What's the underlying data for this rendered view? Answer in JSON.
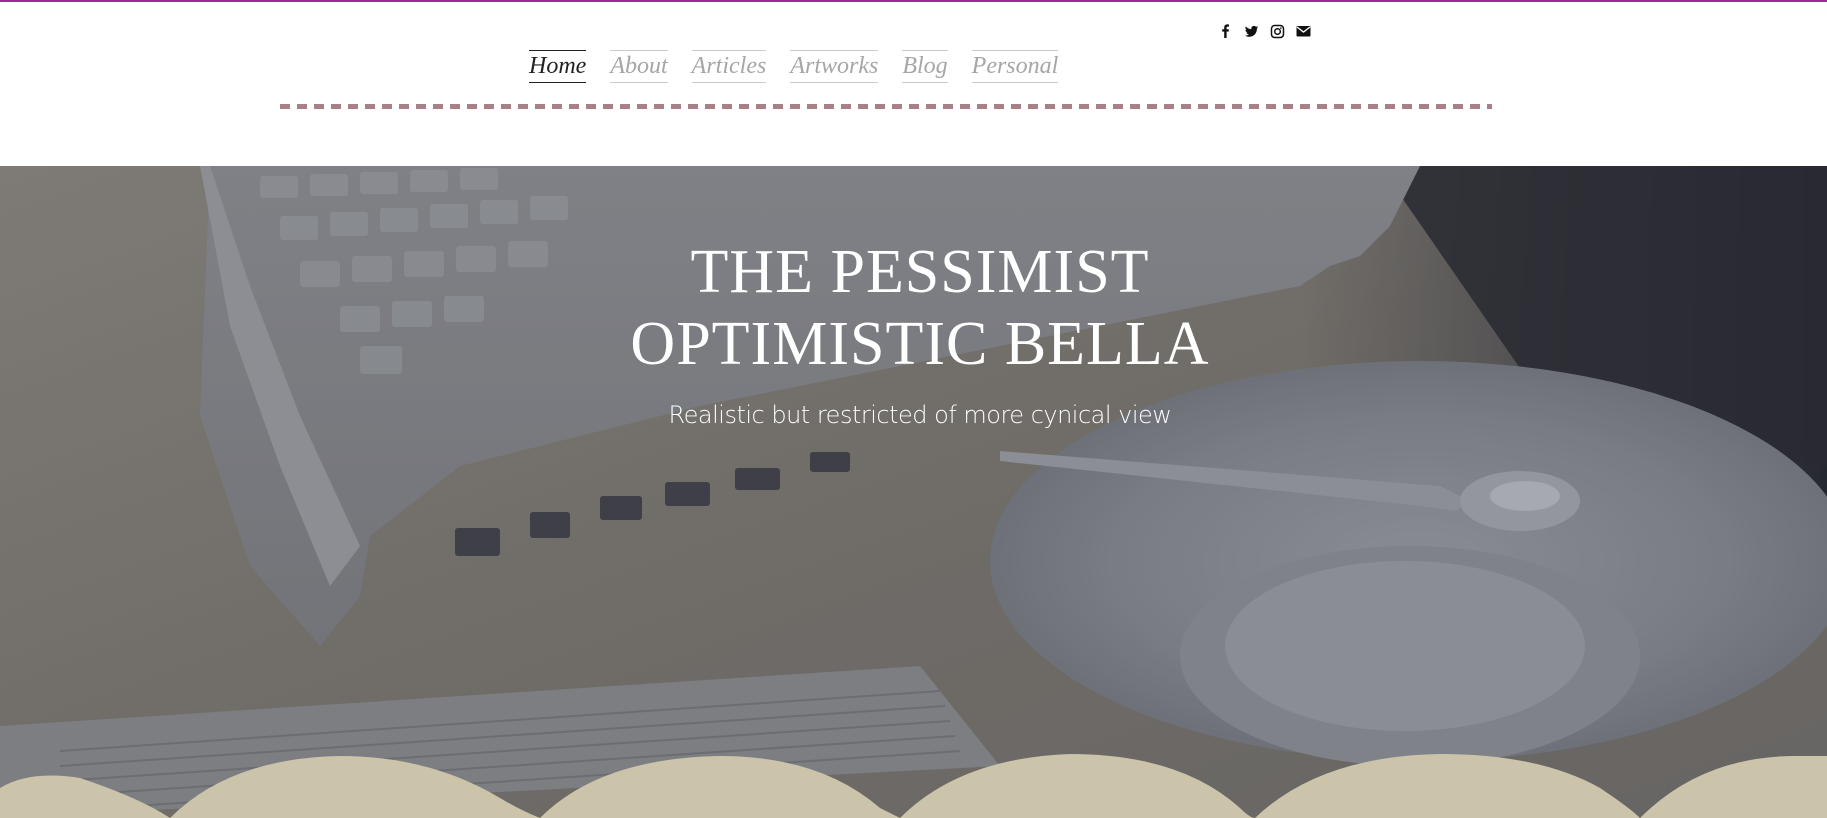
{
  "theme": {
    "accent_line": "#a0278f",
    "divider_color": "#a88088",
    "wave_color": "#cbc4ab",
    "nav_active_color": "#222222",
    "nav_inactive_color": "#a6a6a6"
  },
  "social": {
    "icons": [
      "facebook-icon",
      "twitter-icon",
      "instagram-icon",
      "email-icon"
    ]
  },
  "nav": {
    "items": [
      {
        "label": "Home",
        "active": true
      },
      {
        "label": "About",
        "active": false
      },
      {
        "label": "Articles",
        "active": false
      },
      {
        "label": "Artworks",
        "active": false
      },
      {
        "label": "Blog",
        "active": false
      },
      {
        "label": "Personal",
        "active": false
      }
    ]
  },
  "hero": {
    "title_line1": "THE PESSIMIST",
    "title_line2": "OPTIMISTIC BELLA",
    "subtitle": "Realistic but restricted of more cynical view"
  }
}
